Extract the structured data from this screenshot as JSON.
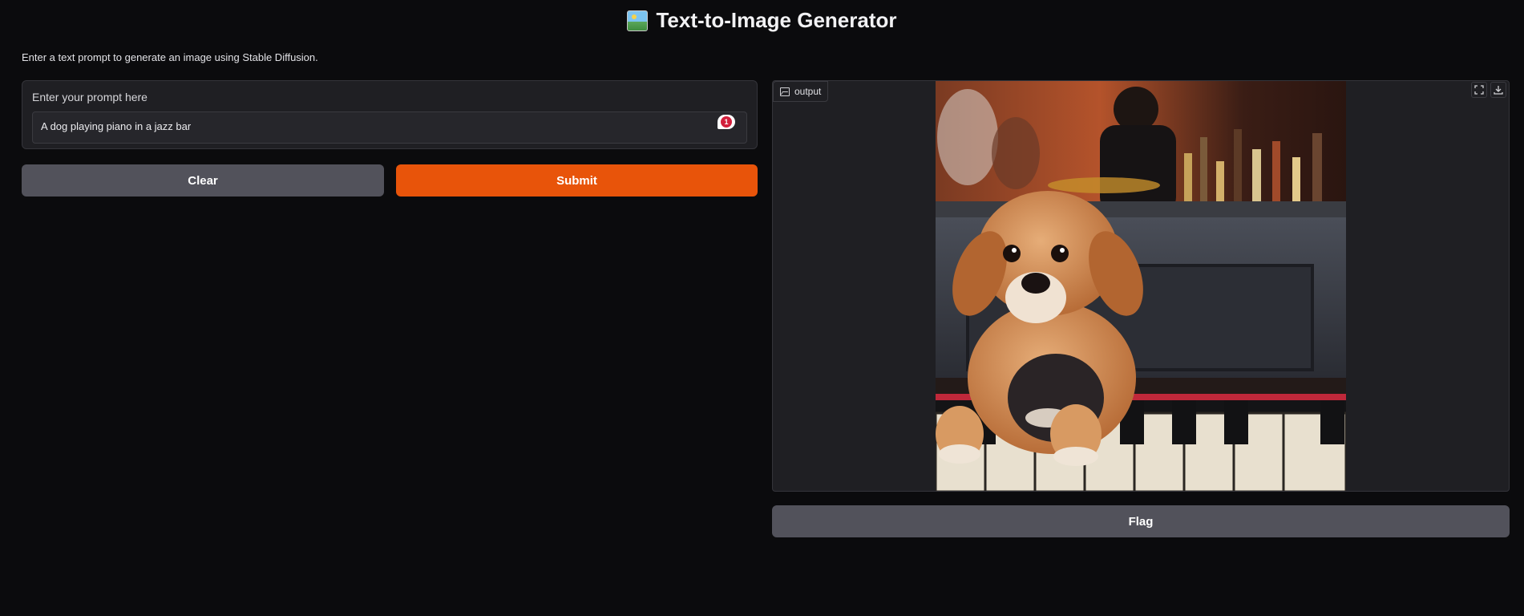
{
  "app": {
    "title": "Text-to-Image Generator",
    "title_icon": "framed-picture-icon",
    "description": "Enter a text prompt to generate an image using Stable Diffusion."
  },
  "prompt": {
    "label": "Enter your prompt here",
    "value": "A dog playing piano in a jazz bar",
    "spellcheck_count": "1"
  },
  "buttons": {
    "clear": "Clear",
    "submit": "Submit",
    "flag": "Flag"
  },
  "output": {
    "label": "output",
    "label_icon": "image-icon",
    "toolbar_icons": [
      "fullscreen-icon",
      "download-icon"
    ]
  },
  "colors": {
    "background": "#0b0b0d",
    "panel": "#1f1f23",
    "primary_button": "#e8540a",
    "secondary_button": "#52525b",
    "spell_badge": "#d21f3c"
  }
}
